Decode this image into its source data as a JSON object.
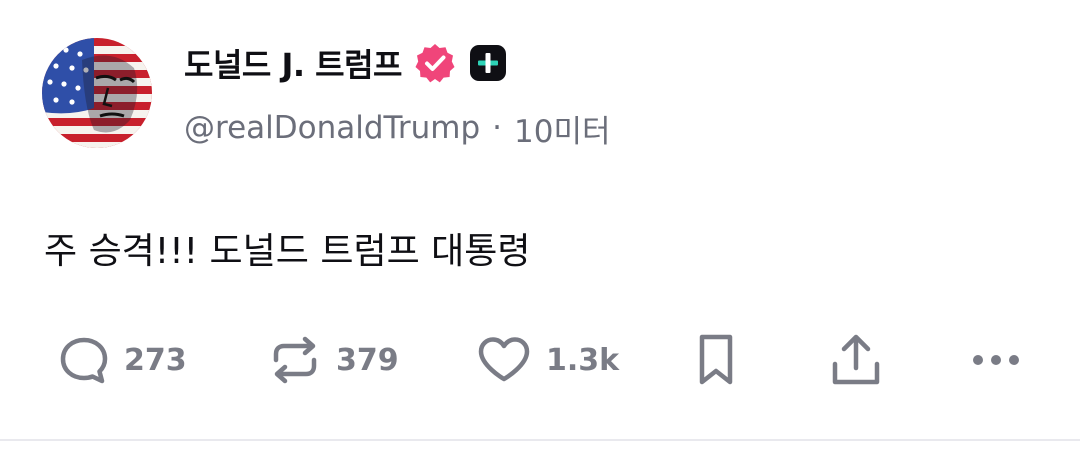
{
  "post": {
    "author": {
      "display_name": "도널드 J. 트럼프",
      "handle": "@realDonaldTrump",
      "separator": "·",
      "time": "10미터",
      "avatar_icon": "avatar-flag-portrait",
      "verified_icon": "verified-badge-icon",
      "verified_color": "#f0457a",
      "plus_icon": "plus-badge-icon"
    },
    "content": "주 승격!!! 도널드 트럼프 대통령",
    "actions": {
      "replies": {
        "icon": "reply-icon",
        "count": "273"
      },
      "reposts": {
        "icon": "repost-icon",
        "count": "379"
      },
      "likes": {
        "icon": "heart-icon",
        "count": "1.3k"
      },
      "bookmark": {
        "icon": "bookmark-icon"
      },
      "share": {
        "icon": "share-icon"
      },
      "more": {
        "icon": "more-icon"
      }
    },
    "colors": {
      "text": "#0f0f14",
      "muted": "#6b6e7a",
      "icon": "#7a7c86"
    }
  }
}
